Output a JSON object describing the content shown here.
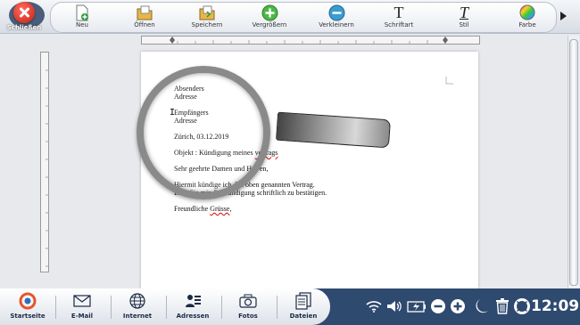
{
  "close": {
    "label": "Schließen"
  },
  "toolbar": {
    "items": [
      {
        "label": "Neu",
        "icon": "new-document-icon"
      },
      {
        "label": "Öffnen",
        "icon": "open-folder-icon"
      },
      {
        "label": "Speichern",
        "icon": "save-icon"
      },
      {
        "label": "Vergrößern",
        "icon": "zoom-in-icon"
      },
      {
        "label": "Verkleinern",
        "icon": "zoom-out-icon"
      },
      {
        "label": "Schriftart",
        "icon": "font-icon"
      },
      {
        "label": "Stil",
        "icon": "style-icon"
      },
      {
        "label": "Farbe",
        "icon": "color-palette-icon"
      }
    ],
    "more_icon": "chevron-right-icon"
  },
  "letter": {
    "sender": [
      "Absenders",
      "Adresse"
    ],
    "recipient": [
      "Empfängers",
      "Adresse"
    ],
    "date_line": "Zürich, 03.12.2019",
    "subject_prefix": "Objekt : Kündigung meines ",
    "subject_misspelled": "vertrags",
    "salutation_prefix": "Sehr geehrte Damen und ",
    "salutation_cut": "Herren,",
    "body1": "Hiermit kündige ich den oben genannten Vertrag.",
    "body2": "Bitte Sie mir die Kündigung schriftlich zu bestätigen.",
    "closing_prefix": "Freundliche ",
    "closing_misspelled": "Grüsse",
    "closing_suffix": ","
  },
  "dock": {
    "items": [
      {
        "label": "Startseite",
        "icon": "home-logo-icon"
      },
      {
        "label": "E-Mail",
        "icon": "mail-icon"
      },
      {
        "label": "Internet",
        "icon": "globe-icon"
      },
      {
        "label": "Adressen",
        "icon": "contacts-icon"
      },
      {
        "label": "Fotos",
        "icon": "camera-icon"
      },
      {
        "label": "Dateien",
        "icon": "files-icon"
      }
    ]
  },
  "tray": {
    "icons": [
      "wifi-icon",
      "volume-icon",
      "battery-icon",
      "zoom-out-icon",
      "zoom-in-icon",
      "moon-icon",
      "trash-icon",
      "help-lifebuoy-icon"
    ],
    "clock": "12:09"
  },
  "colors": {
    "accent": "#2f4a6f",
    "close": "#c81f12"
  }
}
